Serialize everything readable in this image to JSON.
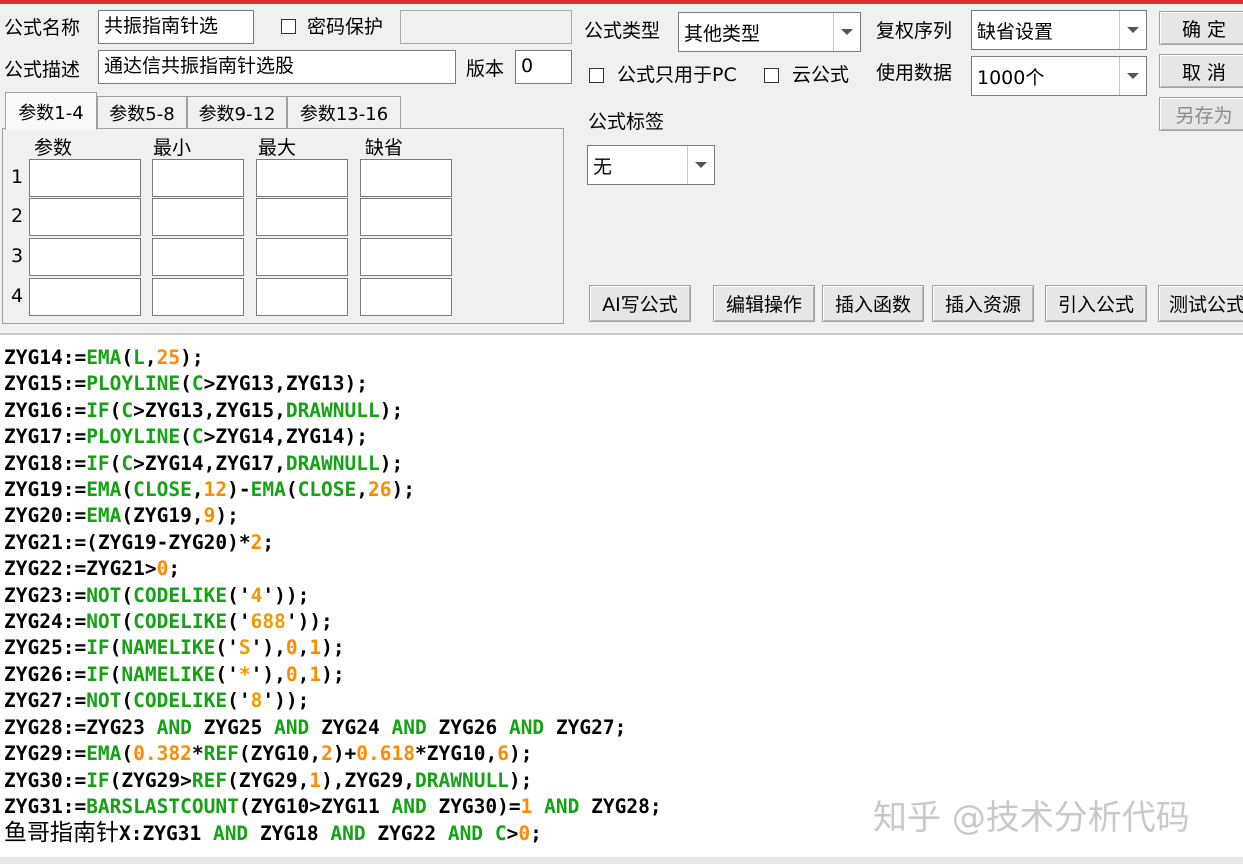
{
  "header": {
    "name_label": "公式名称",
    "name_value": "共振指南针选",
    "password_label": "密码保护",
    "password_value": "",
    "desc_label": "公式描述",
    "desc_value": "通达信共振指南针选股",
    "version_label": "版本",
    "version_value": "0"
  },
  "formula_type": {
    "label": "公式类型",
    "value": "其他类型"
  },
  "adjust": {
    "label": "复权序列",
    "value": "缺省设置"
  },
  "options": {
    "pc_only_label": "公式只用于PC",
    "cloud_label": "云公式",
    "data_label": "使用数据",
    "data_value": "1000个"
  },
  "tag": {
    "label": "公式标签",
    "value": "无"
  },
  "buttons": {
    "ok": "确  定",
    "cancel": "取  消",
    "save_as": "另存为"
  },
  "tabs": [
    "参数1-4",
    "参数5-8",
    "参数9-12",
    "参数13-16"
  ],
  "params": {
    "col_param": "参数",
    "col_min": "最小",
    "col_max": "最大",
    "col_default": "缺省",
    "rows": [
      "1",
      "2",
      "3",
      "4"
    ]
  },
  "toolbar": {
    "ai": "AI写公式",
    "edit": "编辑操作",
    "insert_func": "插入函数",
    "insert_res": "插入资源",
    "import": "引入公式",
    "test": "测试公式"
  },
  "code": {
    "lines": [
      "ZYG14:=EMA(L,25);",
      "ZYG15:=PLOYLINE(C>ZYG13,ZYG13);",
      "ZYG16:=IF(C>ZYG13,ZYG15,DRAWNULL);",
      "ZYG17:=PLOYLINE(C>ZYG14,ZYG14);",
      "ZYG18:=IF(C>ZYG14,ZYG17,DRAWNULL);",
      "ZYG19:=EMA(CLOSE,12)-EMA(CLOSE,26);",
      "ZYG20:=EMA(ZYG19,9);",
      "ZYG21:=(ZYG19-ZYG20)*2;",
      "ZYG22:=ZYG21>0;",
      "ZYG23:=NOT(CODELIKE('4'));",
      "ZYG24:=NOT(CODELIKE('688'));",
      "ZYG25:=IF(NAMELIKE('S'),0,1);",
      "ZYG26:=IF(NAMELIKE('*'),0,1);",
      "ZYG27:=NOT(CODELIKE('8'));",
      "ZYG28:=ZYG23 AND ZYG25 AND ZYG24 AND ZYG26 AND ZYG27;",
      "ZYG29:=EMA(0.382*REF(ZYG10,2)+0.618*ZYG10,6);",
      "ZYG30:=IF(ZYG29>REF(ZYG29,1),ZYG29,DRAWNULL);",
      "ZYG31:=BARSLASTCOUNT(ZYG10>ZYG11 AND ZYG30)=1 AND ZYG28;",
      "鱼哥指南针X:ZYG31 AND ZYG18 AND ZYG22 AND C>0;"
    ]
  },
  "watermark": "知乎 @技术分析代码",
  "colors": {
    "function": "#15a215",
    "number": "#ff8a00",
    "string": "#f29a00",
    "accent": "#d9342b"
  }
}
